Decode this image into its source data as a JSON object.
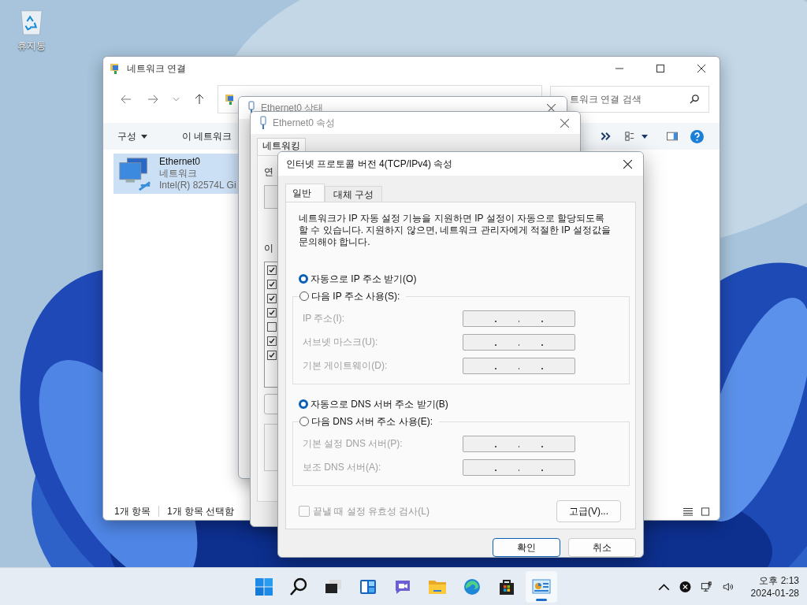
{
  "desktop": {
    "icons": [
      {
        "label": "휴지통"
      }
    ]
  },
  "explorer": {
    "title": "네트워크 연결",
    "search": {
      "placeholder": "트워크 연결 검색"
    },
    "commands": [
      {
        "label": "구성",
        "has_menu": true
      },
      {
        "label": "이 네트워크",
        "has_menu": false
      }
    ],
    "items": [
      {
        "name": "Ethernet0",
        "type": "네트워크",
        "device": "Intel(R) 82574L Gi",
        "selected": true
      }
    ],
    "status": [
      "1개 항목",
      "1개 항목 선택함"
    ]
  },
  "status_dialog": {
    "title": "Ethernet0 상태"
  },
  "properties_dialog": {
    "title": "Ethernet0 속성",
    "tabs": [
      {
        "label": "네트워킹",
        "selected": true
      }
    ],
    "labels": [
      "연",
      "이"
    ],
    "components": [
      {
        "checked": true
      },
      {
        "checked": true
      },
      {
        "checked": true
      },
      {
        "checked": true
      },
      {
        "checked": false
      },
      {
        "checked": true
      },
      {
        "checked": true
      }
    ]
  },
  "ipv4_dialog": {
    "title": "인터넷 프로토콜 버전 4(TCP/IPv4) 속성",
    "tabs": [
      {
        "label": "일반",
        "selected": true
      },
      {
        "label": "대체 구성",
        "selected": false
      }
    ],
    "description": "네트워크가 IP 자동 설정 기능을 지원하면 IP 설정이 자동으로 할당되도록\n할 수 있습니다. 지원하지 않으면, 네트워크 관리자에게 적절한 IP 설정값을\n문의해야 합니다.",
    "groups": [
      {
        "auto": {
          "label": "자동으로 IP 주소 받기(O)",
          "selected": true
        },
        "manual": {
          "label": "다음 IP 주소 사용(S):",
          "selected": false
        },
        "disabled": true,
        "fields": [
          {
            "label": "IP 주소(I):"
          },
          {
            "label": "서브넷 마스크(U):"
          },
          {
            "label": "기본 게이트웨이(D):"
          }
        ]
      },
      {
        "auto": {
          "label": "자동으로 DNS 서버 주소 받기(B)",
          "selected": true
        },
        "manual": {
          "label": "다음 DNS 서버 주소 사용(E):",
          "selected": false
        },
        "disabled": true,
        "fields": [
          {
            "label": "기본 설정 DNS 서버(P):"
          },
          {
            "label": "보조 DNS 서버(A):"
          }
        ]
      }
    ],
    "validate": {
      "label": "끝낼 때 설정 유효성 검사(L)",
      "checked": false,
      "disabled": true
    },
    "advanced_button": "고급(V)...",
    "buttons": [
      {
        "label": "확인",
        "default": true
      },
      {
        "label": "취소",
        "default": false
      }
    ]
  },
  "taskbar": {
    "apps": [
      {
        "kind": "start",
        "selected": false
      },
      {
        "kind": "search",
        "selected": false
      },
      {
        "kind": "task-view",
        "selected": false
      },
      {
        "kind": "widgets",
        "selected": false
      },
      {
        "kind": "chat",
        "selected": false
      },
      {
        "kind": "file-explorer",
        "selected": false
      },
      {
        "kind": "edge",
        "selected": false
      },
      {
        "kind": "store",
        "selected": false
      },
      {
        "kind": "control-panel",
        "selected": true
      }
    ],
    "time": "오후 2:13",
    "date": "2024-01-28"
  }
}
